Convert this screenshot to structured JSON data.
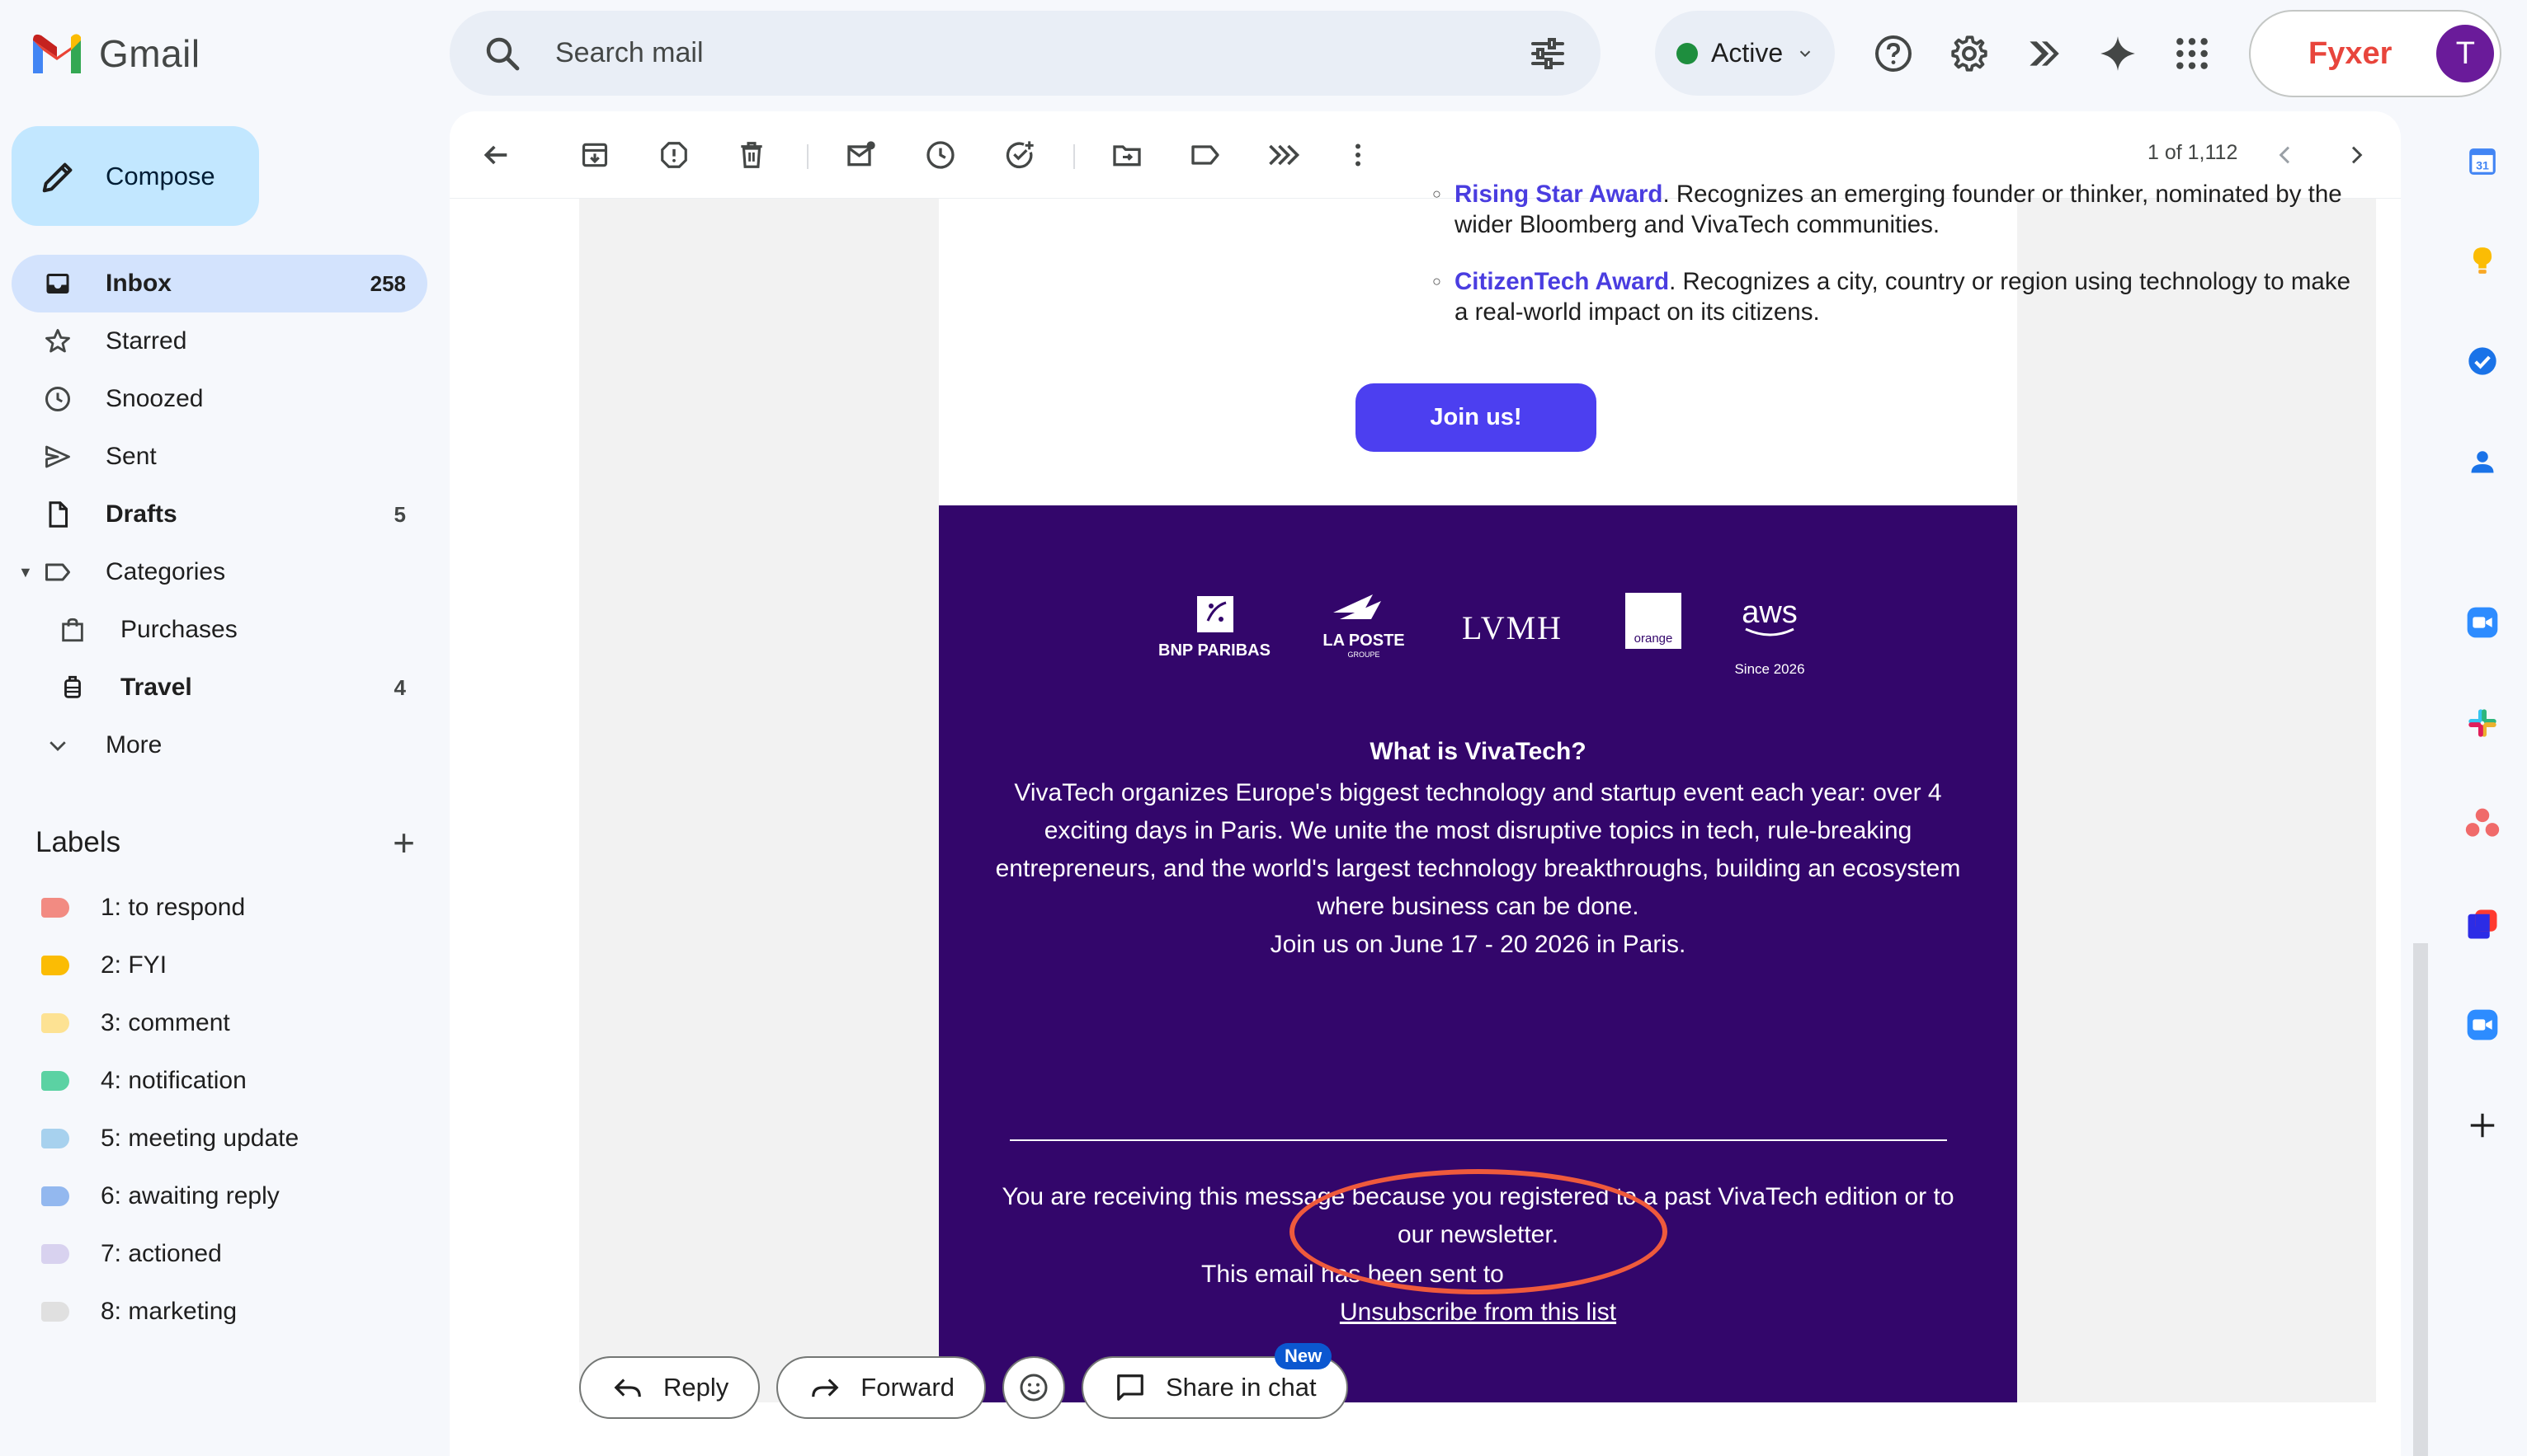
{
  "app": {
    "name": "Gmail"
  },
  "search": {
    "placeholder": "Search mail"
  },
  "status": {
    "label": "Active",
    "color": "#1e8e3e"
  },
  "fyxer": {
    "brand": "Fyxer",
    "avatar_initial": "T",
    "avatar_color": "#6a1b9a"
  },
  "compose": {
    "label": "Compose"
  },
  "nav": {
    "inbox": {
      "label": "Inbox",
      "count": "258"
    },
    "starred": {
      "label": "Starred"
    },
    "snoozed": {
      "label": "Snoozed"
    },
    "sent": {
      "label": "Sent"
    },
    "drafts": {
      "label": "Drafts",
      "count": "5"
    },
    "categories": {
      "label": "Categories"
    },
    "purchases": {
      "label": "Purchases"
    },
    "travel": {
      "label": "Travel",
      "count": "4"
    },
    "more": {
      "label": "More"
    }
  },
  "labels": {
    "heading": "Labels",
    "items": [
      {
        "name": "1: to respond",
        "color": "#f28b82"
      },
      {
        "name": "2: FYI",
        "color": "#fbbc04"
      },
      {
        "name": "3: comment",
        "color": "#fde293"
      },
      {
        "name": "4: notification",
        "color": "#5bd2a3"
      },
      {
        "name": "5: meeting update",
        "color": "#a7d1ee"
      },
      {
        "name": "6: awaiting reply",
        "color": "#93b8ef"
      },
      {
        "name": "7: actioned",
        "color": "#d8d2ef"
      },
      {
        "name": "8: marketing",
        "color": "#e0e0e0"
      }
    ]
  },
  "pager": {
    "text": "1 of 1,112"
  },
  "email": {
    "rising_tail_link": "Rising Star Award",
    "rising_tail_text": ". Recognizes an emerging founder or thinker, nominated by the",
    "rising_line2": "wider Bloomberg and VivaTech communities.",
    "citizen_link": "CitizenTech Award",
    "citizen_text": ". Recognizes a city, country or region using technology to make",
    "citizen_line2": "a real-world impact on its citizens.",
    "join_button": "Join us!",
    "sponsors": {
      "bnp": "BNP PARIBAS",
      "laposte": "LA POSTE",
      "laposte_sub": "GROUPE",
      "lvmh": "LVMH",
      "orange": "orange",
      "aws": "aws",
      "aws_note": "Since 2026"
    },
    "what_title": "What is VivaTech?",
    "what_lines": [
      "VivaTech organizes Europe's biggest technology and startup event each year: over 4",
      "exciting days in Paris. We unite the most disruptive topics in tech, rule-breaking",
      "entrepreneurs, and the world's largest technology breakthroughs, building an ecosystem",
      "where business can be done.",
      "Join us on June 17 - 20 2026 in Paris."
    ],
    "notice_lines": [
      "You are receiving this message because you registered to a past VivaTech edition or to",
      "our newsletter."
    ],
    "sent_to": "This email has been sent to",
    "unsubscribe": "Unsubscribe from this list"
  },
  "actions": {
    "reply": "Reply",
    "forward": "Forward",
    "share": "Share in chat",
    "new_badge": "New"
  },
  "rail": {
    "calendar_day": "31"
  }
}
